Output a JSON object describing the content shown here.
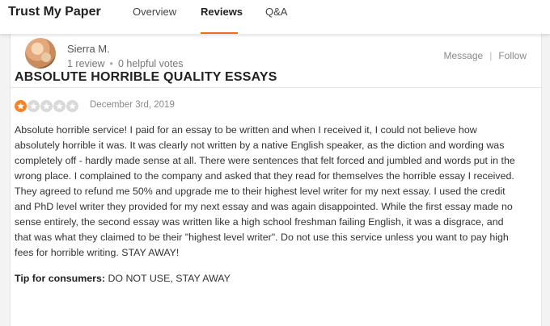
{
  "header": {
    "brand": "Trust My Paper",
    "tabs": [
      {
        "label": "Overview",
        "active": false
      },
      {
        "label": "Reviews",
        "active": true
      },
      {
        "label": "Q&A",
        "active": false
      }
    ]
  },
  "reviewer": {
    "name": "Sierra M.",
    "review_count": "1 review",
    "helpful_votes": "0 helpful votes",
    "message_label": "Message",
    "follow_label": "Follow"
  },
  "review": {
    "title": "ABSOLUTE HORRIBLE QUALITY ESSAYS",
    "rating": 1,
    "max_rating": 5,
    "date": "December 3rd, 2019",
    "body": "Absolute horrible service! I paid for an essay to be written and when I received it, I could not believe how absolutely horrible it was. It was clearly not written by a native English speaker, as the diction and wording was completely off - hardly made sense at all. There were sentences that felt forced and jumbled and words put in the wrong place. I complained to the company and asked that they read for themselves the horrible essay I received. They agreed to refund me 50% and upgrade me to their highest level writer for my next essay. I used the credit and PhD level writer they provided for my next essay and was again disappointed. While the first essay made no sense entirely, the second essay was written like a high school freshman failing English, it was a disgrace, and that was what they claimed to be their \"highest level writer\". Do not use this service unless you want to pay high fees for horrible writing. STAY AWAY!",
    "tip_label": "Tip for consumers:",
    "tip_text": "DO NOT USE, STAY AWAY"
  },
  "colors": {
    "accent": "#f06a1d",
    "star_on": "#f4832a",
    "star_off": "#d9d9d9"
  },
  "icons": {
    "star": "star-icon",
    "avatar": "reviewer-photo"
  }
}
